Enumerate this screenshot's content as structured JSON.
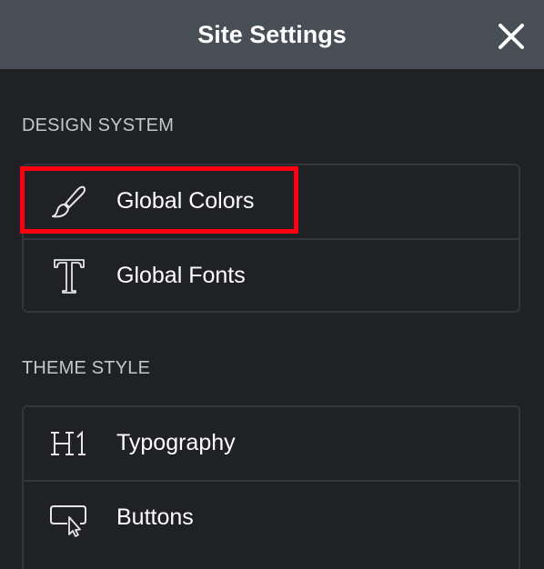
{
  "header": {
    "title": "Site Settings",
    "close_icon": "close-icon"
  },
  "design_system": {
    "title": "DESIGN SYSTEM",
    "items": [
      {
        "label": "Global Colors",
        "icon": "paintbrush-icon"
      },
      {
        "label": "Global Fonts",
        "icon": "typeface-t-icon"
      }
    ]
  },
  "theme_style": {
    "title": "THEME STYLE",
    "items": [
      {
        "label": "Typography",
        "icon": "heading-h1-icon"
      },
      {
        "label": "Buttons",
        "icon": "button-cursor-icon"
      }
    ]
  },
  "colors": {
    "header_bg": "#484e55",
    "panel_bg": "#1f2124",
    "border": "#33363b",
    "highlight": "#ff0010"
  }
}
